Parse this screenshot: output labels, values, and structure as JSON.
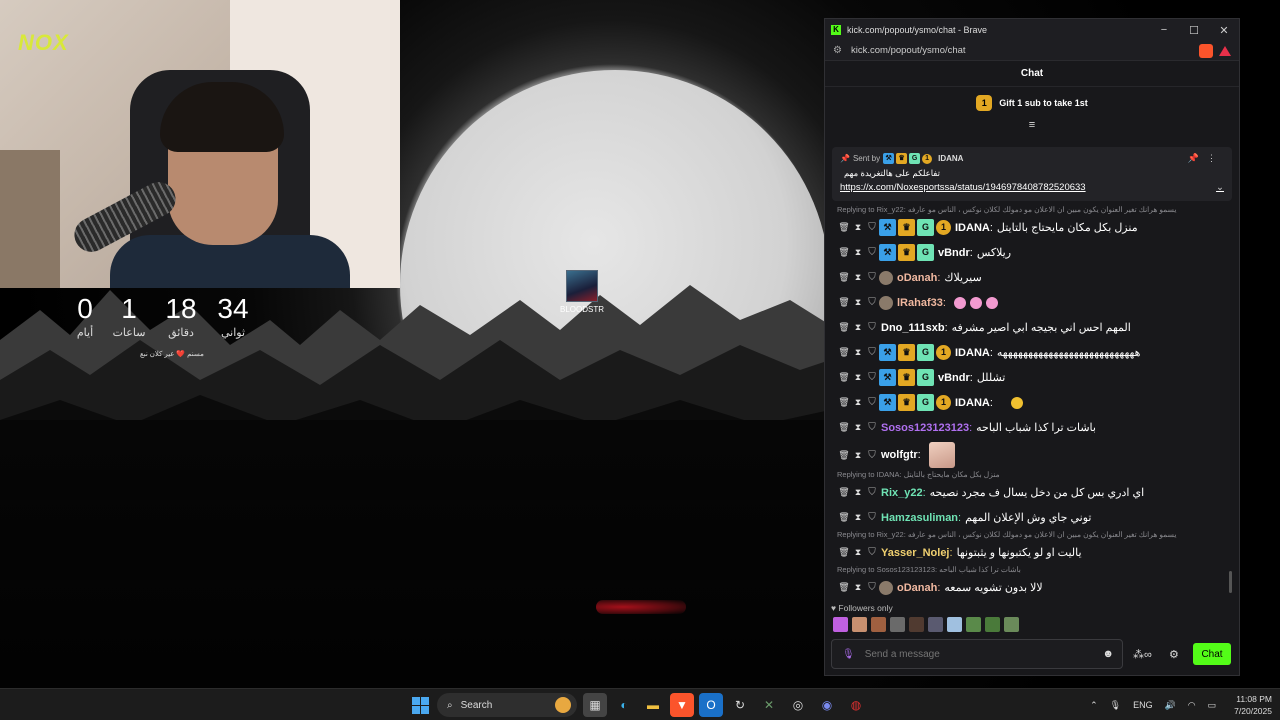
{
  "logo_text": "NOX",
  "countdown": {
    "days_value": "0",
    "days_label": "أيام",
    "hours_value": "1",
    "hours_label": "ساعات",
    "minutes_value": "18",
    "minutes_label": "دقائق",
    "seconds_value": "34",
    "seconds_label": "ثواني",
    "subtitle": "مسنم ❤️ عير كلان نبع"
  },
  "desktop_icon": {
    "label": "BLOODSTR"
  },
  "browser": {
    "title": "kick.com/popout/ysmo/chat - Brave",
    "url": "kick.com/popout/ysmo/chat",
    "accent": "#53fc18"
  },
  "chat": {
    "header": "Chat",
    "gift_rank": "1",
    "gift_text": "Gift 1 sub to take 1st",
    "pinned": {
      "sent_by": "Sent by",
      "user": "IDANA",
      "coin": "1",
      "line1": "تفاعلكم على هالتغريدة مهم",
      "link": "https://x.com/Noxesportssa/status/1946978408782520633"
    },
    "messages": [
      {
        "reply": "Replying to Rix_y22: يسمو هرانك تغير العنوان يكون مبين ان الاعلان مو دمولك لكلان نوكس ، الناس مو عارفه",
        "user": "IDANA",
        "color": "#ffffff",
        "badges": [
          "blue",
          "gold",
          "green",
          "coin"
        ],
        "text": "منزل بكل مكان مايحتاج بالتايتل"
      },
      {
        "reply": "",
        "user": "vBndr",
        "color": "#ffffff",
        "badges": [
          "blue",
          "gold",
          "green"
        ],
        "text": "ريلاكس"
      },
      {
        "reply": "",
        "user": "oDanah",
        "color": "#f0b8a0",
        "badges": [
          "gray"
        ],
        "text": "سيريلاك"
      },
      {
        "reply": "",
        "user": "lRahaf33",
        "color": "#f0b8a0",
        "badges": [
          "gray"
        ],
        "text": ""
      },
      {
        "reply": "",
        "user": "Dno_111sxb",
        "color": "#ffffff",
        "badges": [],
        "text": "المهم احس اني بجيجه ابي اصير مشرفه"
      },
      {
        "reply": "",
        "user": "IDANA",
        "color": "#ffffff",
        "badges": [
          "blue",
          "gold",
          "green",
          "coin"
        ],
        "text": "هههههههههههههههههههههههههههه"
      },
      {
        "reply": "",
        "user": "vBndr",
        "color": "#ffffff",
        "badges": [
          "blue",
          "gold",
          "green"
        ],
        "text": "تشللل"
      },
      {
        "reply": "",
        "user": "IDANA",
        "color": "#ffffff",
        "badges": [
          "blue",
          "gold",
          "green",
          "coin"
        ],
        "text": ""
      },
      {
        "reply": "",
        "user": "Sosos123123123",
        "color": "#b070f0",
        "badges": [],
        "text": "باشات ترا كذا شباب الباحه"
      },
      {
        "reply": "",
        "user": "wolfgtr",
        "color": "#ffffff",
        "badges": [],
        "text": ""
      },
      {
        "reply": "Replying to IDANA: منزل بكل مكان مايحتاج بالتايتل",
        "user": "Rix_y22",
        "color": "#6fe3b4",
        "badges": [],
        "text": "اي ادري بس كل من دخل يسال ف مجرد نصيحه"
      },
      {
        "reply": "",
        "user": "Hamzasuliman",
        "color": "#6fe3b4",
        "badges": [],
        "text": "توني جاي وش الإعلان المهم"
      },
      {
        "reply": "Replying to Rix_y22: يسمو هرانك تغير العنوان يكون مبين ان الاعلان مو دمولك لكلان نوكس ، الناس مو عارفه",
        "user": "Yasser_Nolej",
        "color": "#f0d070",
        "badges": [],
        "text": "ياليت او لو يكتبونها و يثبتونها"
      },
      {
        "reply": "Replying to Sosos123123123: باشات ترا كذا شباب الباحه",
        "user": "oDanah",
        "color": "#f0b8a0",
        "badges": [
          "gray"
        ],
        "text": "لالا بدون تشويه سمعه"
      }
    ],
    "followers_only": "Followers only",
    "input_placeholder": "Send a message",
    "send_label": "Chat"
  },
  "taskbar": {
    "search_label": "Search",
    "lang": "ENG",
    "time": "11:08 PM",
    "date": "7/20/2025",
    "discord_badge": "99"
  }
}
